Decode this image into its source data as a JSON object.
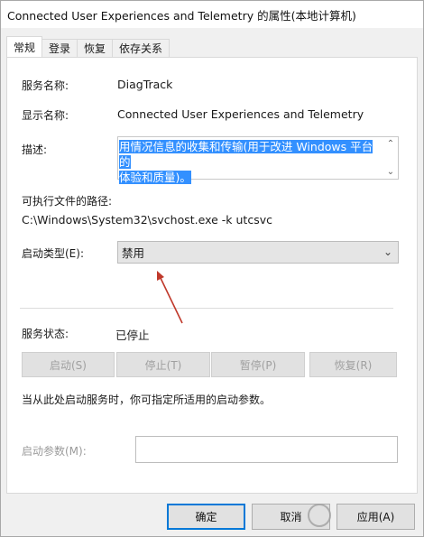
{
  "window": {
    "title": "Connected User Experiences and Telemetry 的属性(本地计算机)"
  },
  "tabs": [
    {
      "label": "常规",
      "active": true
    },
    {
      "label": "登录",
      "active": false
    },
    {
      "label": "恢复",
      "active": false
    },
    {
      "label": "依存关系",
      "active": false
    }
  ],
  "general": {
    "service_name_label": "服务名称:",
    "service_name_value": "DiagTrack",
    "display_name_label": "显示名称:",
    "display_name_value": "Connected User Experiences and Telemetry",
    "description_label": "描述:",
    "description_line1": "用情况信息的收集和传输(用于改进 Windows 平台的",
    "description_line2": "体验和质量)。",
    "exe_path_label": "可执行文件的路径:",
    "exe_path_value": "C:\\Windows\\System32\\svchost.exe -k utcsvc",
    "startup_type_label": "启动类型(E):",
    "startup_type_value": "禁用",
    "service_status_label": "服务状态:",
    "service_status_value": "已停止",
    "hint_text": "当从此处启动服务时，你可指定所适用的启动参数。",
    "start_params_label": "启动参数(M):",
    "start_params_value": ""
  },
  "service_buttons": {
    "start": "启动(S)",
    "stop": "停止(T)",
    "pause": "暂停(P)",
    "resume": "恢复(R)"
  },
  "dialog_buttons": {
    "ok": "确定",
    "cancel": "取消",
    "apply": "应用(A)"
  },
  "colors": {
    "selection": "#3390ff",
    "annotation_arrow": "#c0392b",
    "window_bg": "#f0f0f0"
  }
}
